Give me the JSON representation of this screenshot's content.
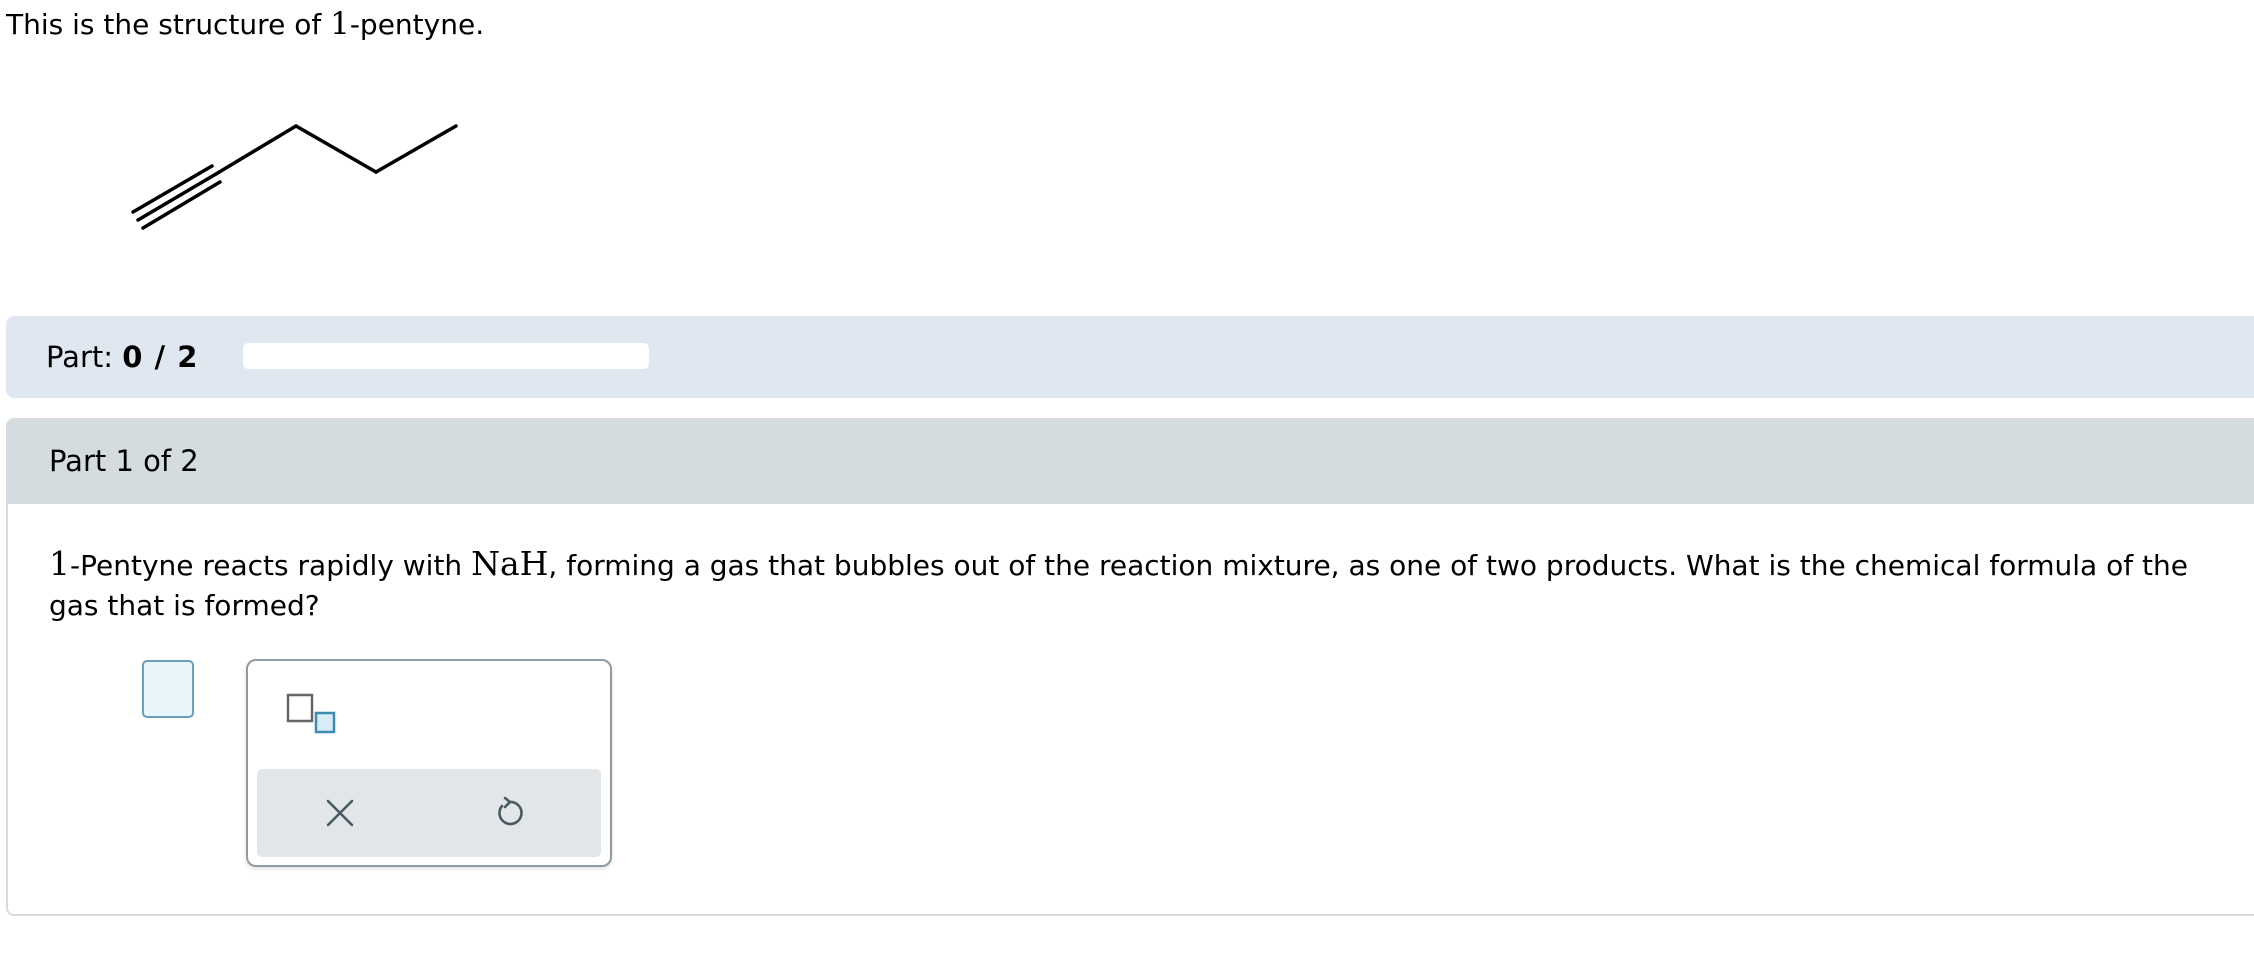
{
  "intro": {
    "prefix": "This is the structure of ",
    "number": "1",
    "suffix": "-pentyne."
  },
  "progress": {
    "label": "Part: ",
    "value": "0 / 2",
    "fraction": 0
  },
  "part": {
    "title": "Part 1 of 2"
  },
  "question": {
    "number": "1",
    "text_a": "-Pentyne reacts rapidly with ",
    "reagent": "NaH",
    "text_b": ", forming a gas that bubbles out of the reaction mixture, as one of two products. What is the chemical formula of the gas that is formed?"
  },
  "palette": {
    "template_icon": "subscript-template-icon",
    "clear_icon": "close-icon",
    "undo_icon": "undo-icon"
  },
  "colors": {
    "progress_bar_bg": "#dfe8f0",
    "card_header_bg": "#d5dcdf",
    "answer_box_border": "#6a9fb7",
    "answer_box_fill": "#eaf4fb",
    "icon_accent": "#3b8cb0"
  }
}
